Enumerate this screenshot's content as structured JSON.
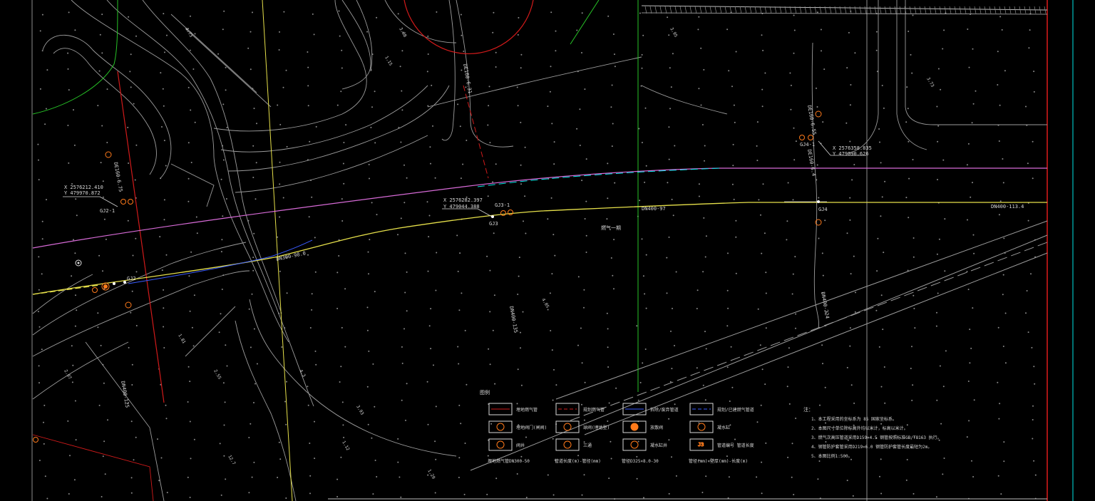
{
  "drawing": {
    "title": "",
    "colors": {
      "background": "#000000",
      "frame_red": "#d11a1a",
      "gas_main_yellow": "#e6e04a",
      "road_magenta": "#d86bd8",
      "green": "#27c427",
      "boundary_cyan": "#00e5e5",
      "symbol_orange": "#ff7a1a",
      "terrain_gray": "#9a9a9a",
      "blue_line": "#3a5bff"
    }
  },
  "points": {
    "gj2_x": "X 2576212.410",
    "gj2_y": "Y 479970.872",
    "gj3_x": "X 2576282.397",
    "gj3_y": "Y 479044.388",
    "gj4_x": "X 2576358.835",
    "gj4_y": "Y 479090.626",
    "gj2_label": "GJ2-1",
    "gj2b_label": "GJ2",
    "gj3_label": "GJ3",
    "gj3_1_label": "GJ3-1",
    "gj4_label": "GJ4",
    "gj4_1_label": "GJ4-1"
  },
  "pipe_labels": {
    "dn300": "DN300-98.0",
    "dn400_left": "DN400-97",
    "dn400_right": "DN400-113.4",
    "dn_vertical_1": "DN400-125",
    "dn_vertical_2": "DN400-224",
    "dn_mid": "DN400-135",
    "de_label": "DE160-6.31",
    "de_label_2": "DE160-6.75",
    "de_label_3": "DE160-6.55",
    "de_label_4": "DE160-6.4",
    "note_mid": "燃气一期"
  },
  "legend": {
    "title": "图例",
    "row1": [
      "埋地燃气管",
      "规划燃气管",
      "拆除/废弃管道",
      "规划/已建燃气管道"
    ],
    "row2": [
      "埋地阀门(闸阀)",
      "球阀(埋地型)",
      "放散阀",
      "凝水缸"
    ],
    "row3": [
      "阀井",
      "三通",
      "凝水缸井",
      "管道编号 管道长度"
    ],
    "row4": [
      "埋地燃气管DN300-50",
      "管道长度(m)-管径(mm)",
      "管径D325×8.0-30",
      "管径(mm)×壁厚(mm)-长度(m)"
    ],
    "row3_last_box": "J3"
  },
  "notes": {
    "title": "注：",
    "items": [
      "1、本工程采用的坐标系为 85 国家坐标系。",
      "2、本图尺寸单位除标高外均以米计，标高以米计。",
      "3、燃气次高压管道采用D159×4.5 钢管按照标准GB/T8163 执行。",
      "4、钢管防护套管采用D219×6.0 钢管防护套管长度最短为2m。",
      "5、本图比例1:500。"
    ]
  },
  "terrain_numbers": [
    "1.81",
    "2.55",
    "4.3",
    "3.93",
    "4.05",
    "3.98",
    "3.95",
    "3.73",
    "4.73",
    "1.15",
    "2.07",
    "12.7",
    "1.12",
    "1.29"
  ]
}
